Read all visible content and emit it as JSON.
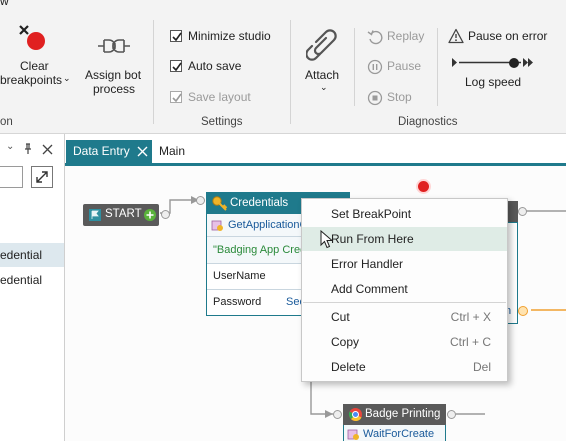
{
  "ribbon": {
    "title_partial": "w",
    "clear_breakpoints_line1": "Clear",
    "clear_breakpoints_line2": "breakpoints",
    "assign_bot_line1": "Assign bot",
    "assign_bot_line2": "process",
    "left_group_label": "on",
    "minimize_studio": "Minimize studio",
    "auto_save": "Auto save",
    "save_layout": "Save layout",
    "settings_label": "Settings",
    "attach": "Attach",
    "replay": "Replay",
    "pause": "Pause",
    "stop": "Stop",
    "pause_on_error": "Pause on error",
    "log_speed": "Log speed",
    "diagnostics_label": "Diagnostics"
  },
  "left_panel": {
    "items": [
      "edential",
      "edential"
    ]
  },
  "tabs": [
    {
      "label": "Data Entry"
    },
    {
      "label": "Main"
    }
  ],
  "canvas": {
    "start_label": "START",
    "credentials": {
      "title": "Credentials",
      "action": "GetApplicationC",
      "string_value": "\"Badging App Cred",
      "username_label": "UserName",
      "password_label": "Password",
      "password_value": "Sec"
    },
    "right_partial_text": "n",
    "badge_printing": {
      "title": "Badge Printing",
      "action": "WaitForCreate"
    }
  },
  "context_menu": {
    "items": [
      {
        "label": "Set BreakPoint",
        "shortcut": ""
      },
      {
        "label": "Run From Here",
        "shortcut": ""
      },
      {
        "label": "Error Handler",
        "shortcut": ""
      },
      {
        "label": "Add Comment",
        "shortcut": ""
      },
      {
        "label": "Cut",
        "shortcut": "Ctrl + X"
      },
      {
        "label": "Copy",
        "shortcut": "Ctrl + C"
      },
      {
        "label": "Delete",
        "shortcut": "Del"
      }
    ]
  },
  "colors": {
    "accent": "#1f7a8c",
    "breakpoint": "#e02020",
    "node_dark": "#5a5a5a",
    "connector_orange": "#f0a030"
  }
}
